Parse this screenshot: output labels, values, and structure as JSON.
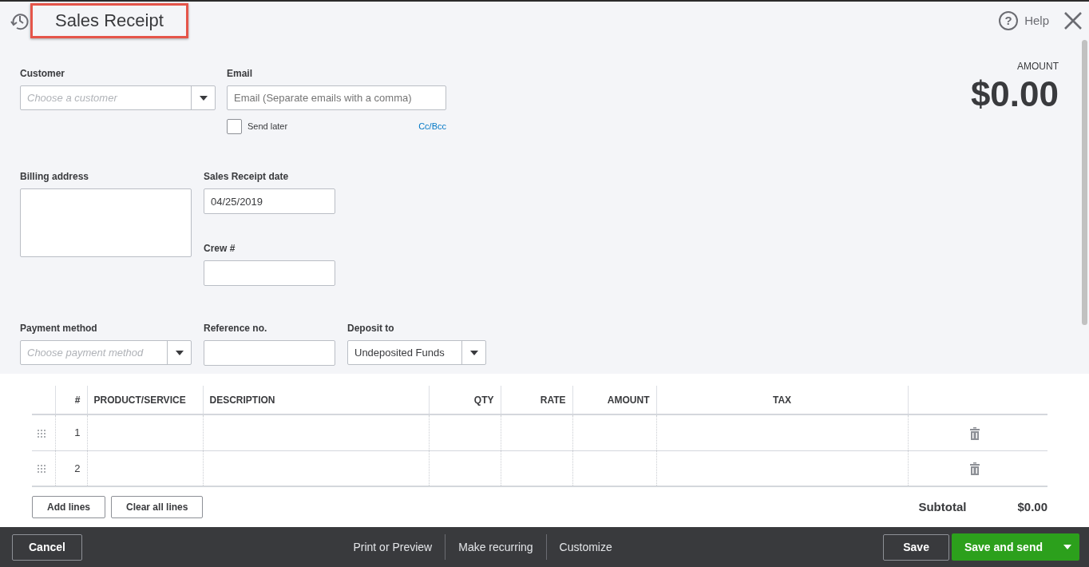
{
  "header": {
    "title": "Sales Receipt",
    "title_highlighted": true,
    "help_icon": "?",
    "help": "Help"
  },
  "customer": {
    "label": "Customer",
    "placeholder": "Choose a customer"
  },
  "email": {
    "label": "Email",
    "placeholder": "Email (Separate emails with a comma)",
    "send_later": {
      "label": "Send later",
      "checked": false
    },
    "cc_bcc": "Cc/Bcc"
  },
  "amount": {
    "label": "AMOUNT",
    "value": "$0.00"
  },
  "billing_address": {
    "label": "Billing address"
  },
  "sales_receipt_date": {
    "label": "Sales Receipt date",
    "value": "04/25/2019"
  },
  "crew": {
    "label": "Crew #"
  },
  "payment_method": {
    "label": "Payment method",
    "placeholder": "Choose payment method"
  },
  "reference_no": {
    "label": "Reference no."
  },
  "deposit_to": {
    "label": "Deposit to",
    "value": "Undeposited Funds"
  },
  "table": {
    "columns": [
      "#",
      "PRODUCT/SERVICE",
      "DESCRIPTION",
      "QTY",
      "RATE",
      "AMOUNT",
      "TAX"
    ],
    "rows": [
      {
        "number": "1"
      },
      {
        "number": "2"
      }
    ]
  },
  "line_buttons": [
    "Add lines",
    "Clear all lines"
  ],
  "subtotal": {
    "label": "Subtotal",
    "value": "$0.00"
  },
  "footer": {
    "cancel": "Cancel",
    "links": [
      "Print or Preview",
      "Make recurring",
      "Customize"
    ],
    "save": "Save",
    "save_and_send": "Save and send"
  }
}
